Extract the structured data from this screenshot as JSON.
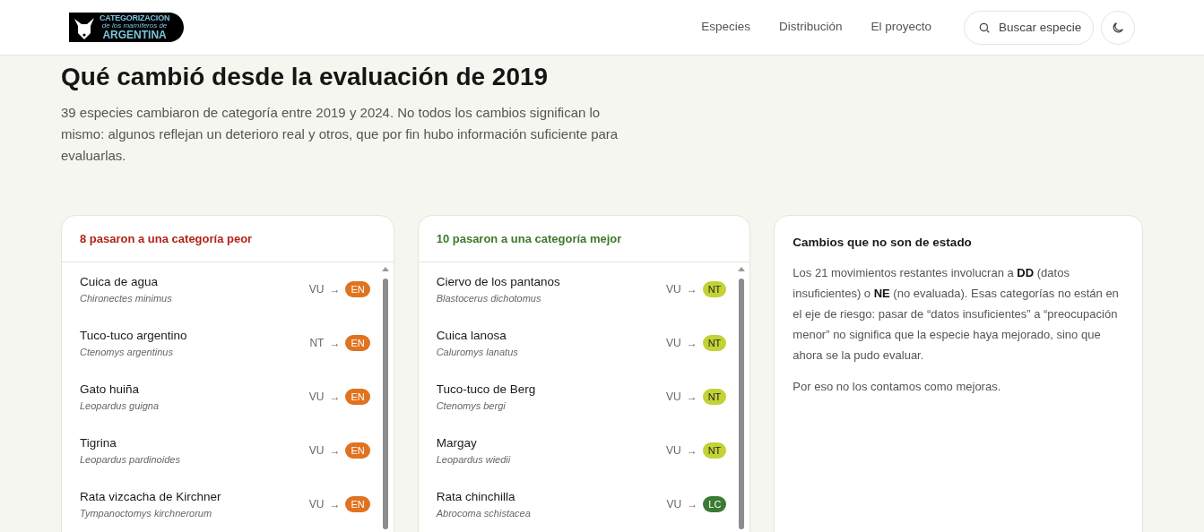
{
  "header": {
    "logo": {
      "line_1": "CATEGORIZACION",
      "line_2": "de los mamíferos de",
      "line_3": "ARGENTINA"
    },
    "nav": [
      "Especies",
      "Distribución",
      "El proyecto"
    ],
    "search": {
      "placeholder": "Buscar especie"
    }
  },
  "intro": {
    "title": "Qué cambió desde la evaluación de 2019",
    "text": "39 especies cambiaron de categoría entre 2019 y 2024. No todos los cambios significan lo mismo: algunos reflejan un deterioro real y otros, que por fin hubo información suficiente para evaluarlas."
  },
  "lists": [
    {
      "title": "8 pasaron a una categoría peor",
      "kind": "worse",
      "rows": [
        {
          "name": "Cuica de agua",
          "scientific": "Chironectes minimus",
          "from": "VU",
          "arrow": "→",
          "to": {
            "code": "EN",
            "color": "#e0731f"
          }
        },
        {
          "name": "Tuco-tuco argentino",
          "scientific": "Ctenomys argentinus",
          "from": "NT",
          "arrow": "→",
          "to": {
            "code": "EN",
            "color": "#e0731f"
          }
        },
        {
          "name": "Gato huiña",
          "scientific": "Leopardus guigna",
          "from": "VU",
          "arrow": "→",
          "to": {
            "code": "EN",
            "color": "#e0731f"
          }
        },
        {
          "name": "Tigrina",
          "scientific": "Leopardus pardinoides",
          "from": "VU",
          "arrow": "→",
          "to": {
            "code": "EN",
            "color": "#e0731f"
          }
        },
        {
          "name": "Rata vizcacha de Kirchner",
          "scientific": "Tympanoctomys kirchnerorum",
          "from": "VU",
          "arrow": "→",
          "to": {
            "code": "EN",
            "color": "#e0731f"
          }
        }
      ]
    },
    {
      "title": "10 pasaron a una categoría mejor",
      "kind": "better",
      "rows": [
        {
          "name": "Ciervo de los pantanos",
          "scientific": "Blastocerus dichotomus",
          "from": "VU",
          "arrow": "→",
          "to": {
            "code": "NT",
            "color": "#c3d234"
          }
        },
        {
          "name": "Cuica lanosa",
          "scientific": "Caluromys lanatus",
          "from": "VU",
          "arrow": "→",
          "to": {
            "code": "NT",
            "color": "#c3d234"
          }
        },
        {
          "name": "Tuco-tuco de Berg",
          "scientific": "Ctenomys bergi",
          "from": "VU",
          "arrow": "→",
          "to": {
            "code": "NT",
            "color": "#c3d234"
          }
        },
        {
          "name": "Margay",
          "scientific": "Leopardus wiedii",
          "from": "VU",
          "arrow": "→",
          "to": {
            "code": "NT",
            "color": "#c3d234"
          }
        },
        {
          "name": "Rata chinchilla",
          "scientific": "Abrocoma schistacea",
          "from": "VU",
          "arrow": "→",
          "to": {
            "code": "LC",
            "color": "#3b7a35"
          }
        }
      ]
    }
  ],
  "note": {
    "title": "Cambios que no son de estado",
    "paragraphs": [
      "Los 21 movimientos restantes involucran a **DD** (datos insuficientes) o **NE** (no evaluada). Esas categorías no están en el eje de riesgo: pasar de “datos insuficientes” a “preocupación menor” no significa que la especie haya mejorado, sino que ahora se la pudo evaluar.",
      "Por eso no los contamos como mejoras."
    ]
  }
}
